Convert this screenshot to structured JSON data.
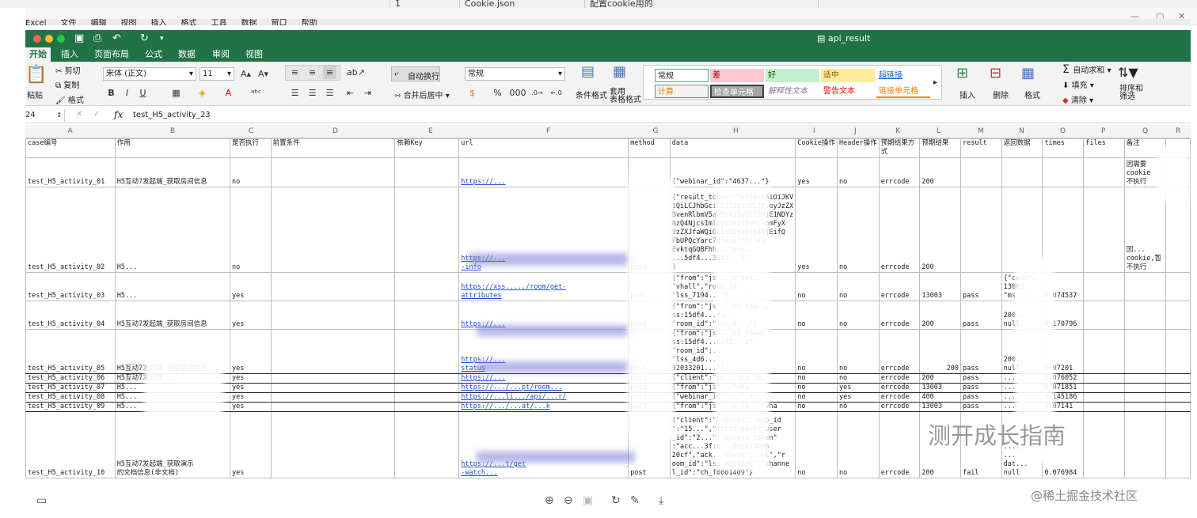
{
  "behind": {
    "cell_a": "1",
    "cell_b": "Cookie.json",
    "cell_c": "配置cookie用的"
  },
  "menubar": {
    "items": [
      "Excel",
      "文件",
      "编辑",
      "视图",
      "插入",
      "格式",
      "工具",
      "数据",
      "窗口",
      "帮助"
    ]
  },
  "window": {
    "title": "api_result",
    "traffic_colors": [
      "#fe5f57",
      "#febc2e",
      "#28c840"
    ]
  },
  "tabs": [
    "开始",
    "插入",
    "页面布局",
    "公式",
    "数据",
    "审阅",
    "视图"
  ],
  "ribbon": {
    "paste": "粘贴",
    "cut": "剪切",
    "copy": "复制",
    "format_painter": "格式",
    "font": "宋体 (正文)",
    "font_size": "11",
    "wrap_text": "自动换行",
    "merge_center": "合并后居中",
    "number_format": "常规",
    "conditional": "条件格式",
    "table_format": "套用\n表格格式",
    "styles": {
      "normal": "常规",
      "bad": "差",
      "good": "好",
      "neutral": "适中",
      "hyperlink": "超链接",
      "calc": "计算",
      "check": "检查单元格",
      "explain": "解释性文本",
      "warn": "警告文本",
      "linked": "链接单元格"
    },
    "insert": "插入",
    "delete": "删除",
    "format": "格式",
    "autosum": "自动求和",
    "fill": "填充",
    "clear": "清除",
    "sort_filter": "排序和\n筛选",
    "bold": "B",
    "italic": "I",
    "underline": "U",
    "percent": "%",
    "thousands": "000",
    "fx": "fx"
  },
  "formula_bar": {
    "cell_ref": "24",
    "value": "test_H5_activity_23"
  },
  "columns": [
    "A",
    "B",
    "C",
    "D",
    "E",
    "F",
    "G",
    "H",
    "I",
    "J",
    "K",
    "L",
    "M",
    "N",
    "O",
    "P",
    "Q",
    "R"
  ],
  "headers": [
    "case编号",
    "作用",
    "是否执行",
    "前置条件",
    "依赖Key",
    "url",
    "method",
    "data",
    "Cookie操作",
    "Header操作",
    "预期结果方式",
    "预期结果",
    "result",
    "返回数据",
    "times",
    "files",
    "备注"
  ],
  "rows": [
    [
      "test_H5_activity_01",
      "H5互动7发起端_获取房间信息",
      "no",
      "",
      "",
      "https://...",
      "",
      "{\"webinar_id\":\"4637...\"}",
      "yes",
      "no",
      "errcode",
      "200",
      "",
      "",
      "",
      "",
      "因需要\ncookie\n不执行"
    ],
    [
      "test_H5_activity_02",
      "H5...",
      "no",
      "",
      "",
      "https://...\n-info",
      "post",
      "{\"result_token\":\"eyJ0eXAiOiJKV\n1QiLCJhbGciOiJIUzI1NiJ9.eyJzZX\nBvenRlbmV5aW5hN19pZCI6MjE1NDYz\nNzQ4NjcsImlzcyI6IjEwMjAbmFyX\nVzZXJfaWQiOiIxNDYzNzQ4NjEifQ\nFbUPQcYarc7gfmzb7fhzlk1\nEvktqGQBFhh...toke...\n...5df4...34fa...f\"\n}",
      "yes",
      "no",
      "errcode",
      "200",
      "",
      "",
      "",
      "",
      "因...\ncookie,暂\n不执行"
    ],
    [
      "test_H5_activity_03",
      "H5...",
      "yes",
      "",
      "",
      "https://xss...../room/get-\nattributes",
      "post",
      "{\"from\":\"js\"...s_tok...\n\"vhall\",\"room_id\":...\n\"lss_7194...\"}",
      "no",
      "no",
      "errcode",
      "13003",
      "pass",
      "{\"code\":\n13003,\n\"ms...",
      "0.074537",
      "",
      ""
    ],
    [
      "test_H5_activity_04",
      "H5互动7发起端_获取房间信息",
      "yes",
      "",
      "",
      "https://...",
      "post",
      "{\"from\":\"js\"...vs_tok...\nss:15df4...f2...\n\"room_id\":\"lss_4...\"}",
      "no",
      "no",
      "errcode",
      "200",
      "pass",
      "200...\nnull",
      "0.170796",
      "",
      ""
    ],
    [
      "test_H5_activity_05",
      "H5互动7发起端_获取活动状态",
      "yes",
      "",
      "",
      "https://...\nstatus",
      "post",
      "{\"from\":\"js\"...vs_token\nss:15df4...c4f2...1f\",\n\"room_id\":...\n\"lss_4d6...\"...\n92033201...\"}",
      "no",
      "no",
      "errcode",
      "200",
      "pass",
      "200...\nnull",
      "0.07201",
      "",
      ""
    ],
    [
      "test_H5_activity_06",
      "H5互动7发起端...",
      "yes",
      "",
      "",
      "https://...",
      "post",
      "{\"client\":\"pc...app_id",
      "no",
      "no",
      "errcode",
      "200",
      "pass",
      "...",
      "0.076052",
      "",
      ""
    ],
    [
      "test_H5_activity_07",
      "H5...",
      "yes",
      "",
      "",
      "https://.../...pt/room...",
      "post",
      "{\"from\":\"js\"...\"vha",
      "no",
      "yes",
      "errcode",
      "13003",
      "pass",
      "...",
      "0.071851",
      "",
      ""
    ],
    [
      "test_H5_activity_08",
      "H5...",
      "yes",
      "",
      "",
      "https://...li.../api/...r/",
      "post",
      "{\"webinar_id\":...\"joi",
      "no",
      "yes",
      "errcode",
      "400",
      "pass",
      "...",
      "0.145186",
      "",
      ""
    ],
    [
      "test_H5_activity_09",
      "H5...",
      "yes",
      "",
      "",
      "https://.../...at/...k",
      "post",
      "{\"from\":\"js\"...s_to...\"vha",
      "no",
      "no",
      "errcode",
      "13003",
      "pass",
      "...",
      "0.07141",
      "",
      ""
    ],
    [
      "test_H5_activity_10",
      "H5互动7发起端_获取演示\n的文档信息(非文档)",
      "yes",
      "",
      "",
      "https://...t/get\n-watch...",
      "post",
      "{\"client\":\"browser\",\"app_id\n\":\"15...\",\"third_party_user\n_id\":\"2...\",\"access_token\"\n:\"acc...3f:6...8de613b96\n20cf\",\"ack...check\":\"sol\",\"r\noom_id\":\"lss_d6bf2d6\",\"channe\nl_id\":\"ch_f0001409\"}",
      "no",
      "no",
      "errcode",
      "200",
      "fail",
      "...toke\n...\ndat...\nnull",
      "0.076984",
      "",
      ""
    ]
  ],
  "watermark": "测开成长指南",
  "footer_watermark": "@稀土掘金技术社区"
}
